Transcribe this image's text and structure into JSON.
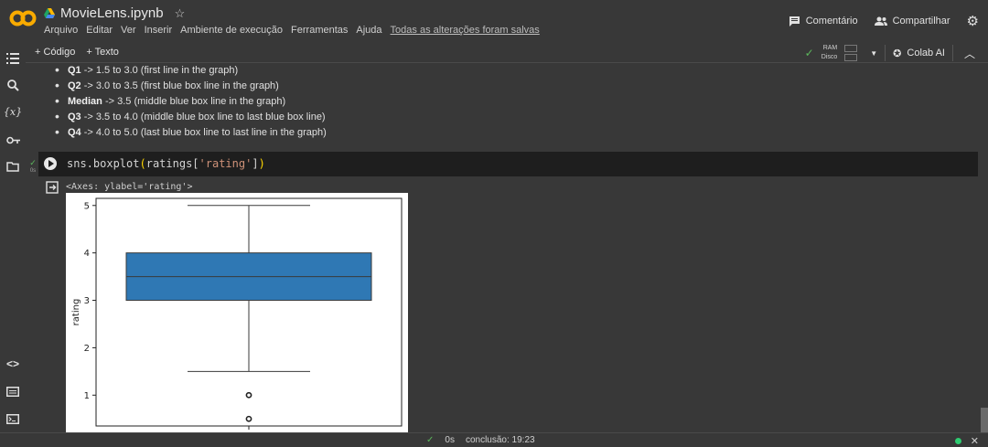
{
  "header": {
    "title": "MovieLens.ipynb",
    "menu": [
      "Arquivo",
      "Editar",
      "Ver",
      "Inserir",
      "Ambiente de execução",
      "Ferramentas",
      "Ajuda"
    ],
    "saved_status": "Todas as alterações foram salvas",
    "comment_label": "Comentário",
    "share_label": "Compartilhar"
  },
  "toolbar": {
    "add_code": "+ Código",
    "add_text": "+ Texto",
    "ram_label": "RAM",
    "disk_label": "Disco",
    "colab_ai": "Colab AI"
  },
  "markdown": {
    "items": [
      {
        "bold": "Q1",
        "text": " -> 1.5 to 3.0 (first line in the graph)"
      },
      {
        "bold": "Q2",
        "text": " -> 3.0 to 3.5 (first blue box line in the graph)"
      },
      {
        "bold": "Median",
        "text": " -> 3.5 (middle blue box line in the graph)"
      },
      {
        "bold": "Q3",
        "text": " -> 3.5 to 4.0 (middle blue box line to last blue box line)"
      },
      {
        "bold": "Q4",
        "text": " -> 4.0 to 5.0 (last blue box line to last line in the graph)"
      }
    ]
  },
  "cell": {
    "code_fn": "sns.boxplot",
    "code_arg_var": "ratings",
    "code_arg_key": "'rating'",
    "exec_time": "0s",
    "output_text": "<Axes: ylabel='rating'>"
  },
  "chart_data": {
    "type": "box",
    "ylabel": "rating",
    "yticks": [
      "1",
      "2",
      "3",
      "4",
      "5"
    ],
    "ylim": [
      0.35,
      5.15
    ],
    "box": {
      "whisker_low": 1.5,
      "q1": 3.0,
      "median": 3.5,
      "q3": 4.0,
      "whisker_high": 5.0
    },
    "outliers": [
      1.0,
      0.5
    ],
    "color": "#2f78b4"
  },
  "status": {
    "time": "0s",
    "completion": "conclusão: 19:23"
  }
}
